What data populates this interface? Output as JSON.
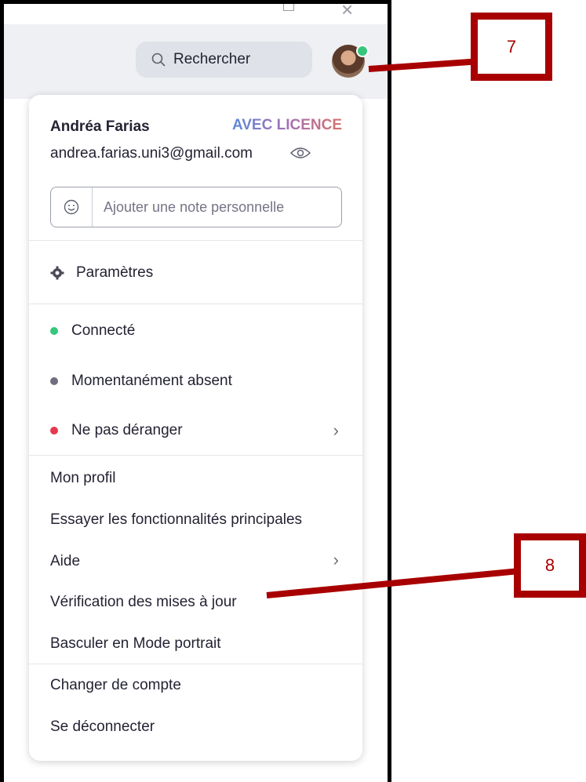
{
  "header": {
    "search_label": "Rechercher"
  },
  "profile": {
    "name": "Andréa Farias",
    "license": "AVEC LICENCE",
    "email": "andrea.farias.uni3@gmail.com",
    "note_placeholder": "Ajouter une note personnelle"
  },
  "menu": {
    "settings": "Paramètres",
    "status": [
      {
        "label": "Connecté",
        "color": "#36c77c"
      },
      {
        "label": "Momentanément absent",
        "color": "#6e6e7e"
      },
      {
        "label": "Ne pas déranger",
        "color": "#e8384f"
      }
    ],
    "links": [
      "Mon profil",
      "Essayer les fonctionnalités principales",
      "Aide",
      "Vérification des mises à jour",
      "Basculer en Mode portrait"
    ],
    "account": [
      "Changer de compte",
      "Se déconnecter"
    ]
  },
  "annotations": {
    "label_7": "7",
    "label_8": "8"
  },
  "colors": {
    "annotation": "#a80000",
    "online": "#36c77c"
  }
}
